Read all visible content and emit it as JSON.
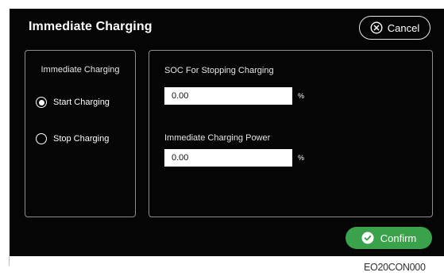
{
  "dialog": {
    "title": "Immediate Charging",
    "cancel_label": "Cancel",
    "confirm_label": "Confirm"
  },
  "mode_group": {
    "label": "Immediate Charging",
    "options": [
      {
        "label": "Start Charging",
        "selected": true
      },
      {
        "label": "Stop Charging",
        "selected": false
      }
    ]
  },
  "fields": {
    "soc": {
      "label": "SOC For Stopping Charging",
      "value": "0.00",
      "unit": "%"
    },
    "power": {
      "label": "Immediate Charging Power",
      "value": "0.00",
      "unit": "%"
    }
  },
  "figure_code": "EO20CON000",
  "icons": {
    "cancel": "close-circle-icon",
    "confirm": "check-circle-icon"
  },
  "colors": {
    "background": "#050505",
    "confirm": "#3aa24a",
    "border": "#8e8e8e"
  }
}
